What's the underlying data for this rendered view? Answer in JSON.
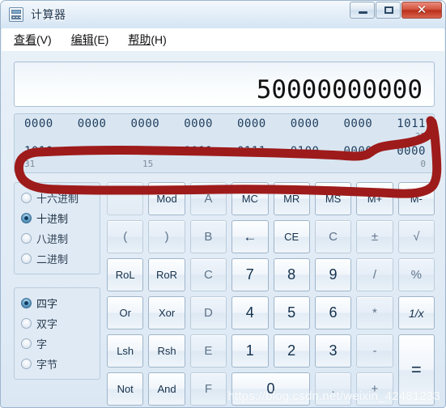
{
  "window": {
    "title": "计算器",
    "icon": "calculator-icon",
    "controls": {
      "minimize": "最小化",
      "maximize": "最大化",
      "close": "✕"
    }
  },
  "menu": {
    "items": [
      {
        "text": "查看",
        "accel": "(V)"
      },
      {
        "text": "编辑",
        "accel": "(E)"
      },
      {
        "text": "帮助",
        "accel": "(H)"
      }
    ]
  },
  "display": {
    "value": "50000000000"
  },
  "binary_panel": {
    "rows": [
      {
        "bits": [
          "0000",
          "0000",
          "0000",
          "0000",
          "0000",
          "0000",
          "0000",
          "1011"
        ],
        "labels": {
          "left": "",
          "mid": "",
          "right": "32"
        }
      },
      {
        "bits": [
          "1010",
          "0100",
          "0011",
          "1011",
          "0111",
          "0100",
          "0000",
          "0000"
        ],
        "labels": {
          "left": "31",
          "mid": "15",
          "right": "0"
        }
      }
    ]
  },
  "base_options": {
    "items": [
      {
        "label": "十六进制",
        "checked": false
      },
      {
        "label": "十进制",
        "checked": true
      },
      {
        "label": "八进制",
        "checked": false
      },
      {
        "label": "二进制",
        "checked": false
      }
    ]
  },
  "word_options": {
    "items": [
      {
        "label": "四字",
        "checked": true
      },
      {
        "label": "双字",
        "checked": false
      },
      {
        "label": "字",
        "checked": false
      },
      {
        "label": "字节",
        "checked": false
      }
    ]
  },
  "keypad": {
    "keys": [
      {
        "label": "",
        "name": "key-blank",
        "style": "blank"
      },
      {
        "label": "Mod",
        "name": "key-mod",
        "style": "small"
      },
      {
        "label": "A",
        "name": "key-hex-a",
        "style": "dim"
      },
      {
        "label": "MC",
        "name": "key-mc",
        "style": "small"
      },
      {
        "label": "MR",
        "name": "key-mr",
        "style": "small"
      },
      {
        "label": "MS",
        "name": "key-ms",
        "style": "small"
      },
      {
        "label": "M+",
        "name": "key-m-plus",
        "style": "small"
      },
      {
        "label": "M-",
        "name": "key-m-minus",
        "style": "small"
      },
      {
        "label": "(",
        "name": "key-paren-open",
        "style": "dim"
      },
      {
        "label": ")",
        "name": "key-paren-close",
        "style": "dim"
      },
      {
        "label": "B",
        "name": "key-hex-b",
        "style": "dim"
      },
      {
        "label": "←",
        "name": "key-backspace",
        "style": "arrow"
      },
      {
        "label": "CE",
        "name": "key-ce",
        "style": "small"
      },
      {
        "label": "C",
        "name": "key-clear",
        "style": "dim"
      },
      {
        "label": "±",
        "name": "key-sign",
        "style": "dim"
      },
      {
        "label": "√",
        "name": "key-sqrt",
        "style": "dim"
      },
      {
        "label": "RoL",
        "name": "key-rol",
        "style": "small"
      },
      {
        "label": "RoR",
        "name": "key-ror",
        "style": "small"
      },
      {
        "label": "C",
        "name": "key-hex-c",
        "style": "dim"
      },
      {
        "label": "7",
        "name": "key-7",
        "style": "num"
      },
      {
        "label": "8",
        "name": "key-8",
        "style": "num"
      },
      {
        "label": "9",
        "name": "key-9",
        "style": "num"
      },
      {
        "label": "/",
        "name": "key-divide",
        "style": "dim"
      },
      {
        "label": "%",
        "name": "key-percent",
        "style": "dim"
      },
      {
        "label": "Or",
        "name": "key-or",
        "style": "small"
      },
      {
        "label": "Xor",
        "name": "key-xor",
        "style": "small"
      },
      {
        "label": "D",
        "name": "key-hex-d",
        "style": "dim"
      },
      {
        "label": "4",
        "name": "key-4",
        "style": "num"
      },
      {
        "label": "5",
        "name": "key-5",
        "style": "num"
      },
      {
        "label": "6",
        "name": "key-6",
        "style": "num"
      },
      {
        "label": "*",
        "name": "key-multiply",
        "style": "dim"
      },
      {
        "label": "1/x",
        "name": "key-reciprocal",
        "style": "italic"
      },
      {
        "label": "Lsh",
        "name": "key-lsh",
        "style": "small"
      },
      {
        "label": "Rsh",
        "name": "key-rsh",
        "style": "small"
      },
      {
        "label": "E",
        "name": "key-hex-e",
        "style": "dim"
      },
      {
        "label": "1",
        "name": "key-1",
        "style": "num"
      },
      {
        "label": "2",
        "name": "key-2",
        "style": "num"
      },
      {
        "label": "3",
        "name": "key-3",
        "style": "num"
      },
      {
        "label": "-",
        "name": "key-subtract",
        "style": "dim"
      },
      {
        "label": "=",
        "name": "key-equals",
        "style": "tall-eq"
      },
      {
        "label": "Not",
        "name": "key-not",
        "style": "small"
      },
      {
        "label": "And",
        "name": "key-and",
        "style": "small"
      },
      {
        "label": "F",
        "name": "key-hex-f",
        "style": "dim"
      },
      {
        "label": "0",
        "name": "key-0",
        "style": "wide0"
      },
      {
        "label": ".",
        "name": "key-decimal",
        "style": "dim"
      },
      {
        "label": "+",
        "name": "key-add",
        "style": "dim"
      }
    ]
  },
  "annotation": {
    "color": "#9e1b1b",
    "shape": "hand-drawn-loop-around-binary-digits"
  },
  "watermark": {
    "text": "https://blog.csdn.net/weixin_42481233"
  }
}
